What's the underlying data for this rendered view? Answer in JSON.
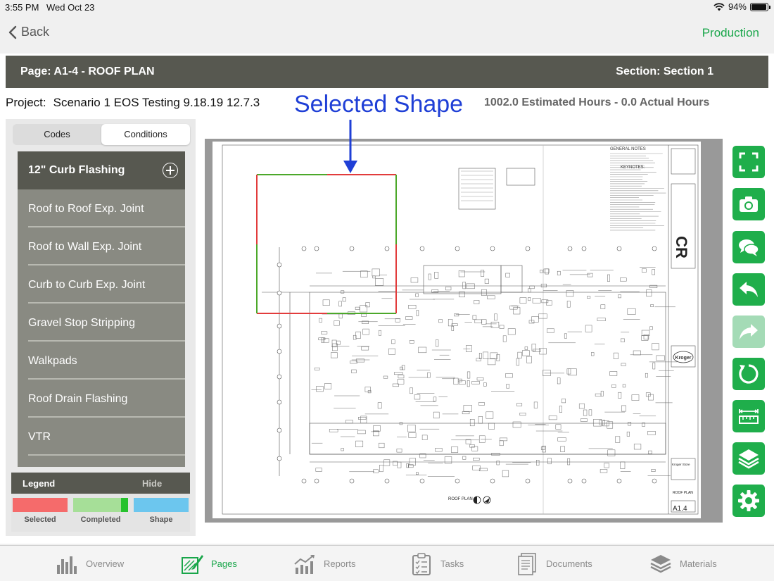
{
  "status_bar": {
    "time": "3:55 PM",
    "date": "Wed Oct 23",
    "battery": "94%",
    "battery_level": 0.94
  },
  "nav": {
    "back_label": "Back",
    "right_label": "Production"
  },
  "page_header": {
    "page": "Page: A1-4 - ROOF PLAN",
    "section": "Section: Section 1"
  },
  "project": {
    "label": "Project:",
    "name": "Scenario 1 EOS Testing 9.18.19 12.7.3",
    "hours": "1002.0 Estimated Hours - 0.0 Actual Hours"
  },
  "annotation": "Selected Shape",
  "tabs": [
    {
      "label": "Codes",
      "active": false
    },
    {
      "label": "Conditions",
      "active": true
    }
  ],
  "conditions": [
    {
      "label": "12\" Curb Flashing",
      "selected": true
    },
    {
      "label": "Roof to Roof Exp. Joint"
    },
    {
      "label": "Roof to Wall Exp. Joint"
    },
    {
      "label": "Curb to Curb Exp. Joint"
    },
    {
      "label": "Gravel Stop Stripping"
    },
    {
      "label": "Walkpads"
    },
    {
      "label": "Roof Drain Flashing"
    },
    {
      "label": "VTR"
    }
  ],
  "legend": {
    "title": "Legend",
    "hide_label": "Hide",
    "items": [
      {
        "label": "Selected",
        "color": "#f56b6b"
      },
      {
        "label": "Completed",
        "color": "#a6df98"
      },
      {
        "label": "Shape",
        "color": "#6cc6ee"
      }
    ]
  },
  "blueprint": {
    "notes_title": "GENERAL NOTES",
    "keynotes_title": "KEYNOTES:",
    "plan_title": "ROOF PLAN",
    "sheet_title": "ROOF PLAN",
    "sheet_number": "A1.4",
    "client_logo": "Kroger",
    "logo_letters": "CR",
    "client_name": "Kroger Store"
  },
  "toolbar": [
    {
      "icon": "fullscreen-icon"
    },
    {
      "icon": "camera-icon"
    },
    {
      "icon": "chat-icon"
    },
    {
      "icon": "undo-icon"
    },
    {
      "icon": "redo-icon",
      "disabled": true
    },
    {
      "icon": "refresh-icon"
    },
    {
      "icon": "measure-icon"
    },
    {
      "icon": "layers-icon"
    },
    {
      "icon": "gear-icon"
    }
  ],
  "bottom_tabs": [
    {
      "label": "Overview",
      "icon": "bar-chart-icon"
    },
    {
      "label": "Pages",
      "icon": "pages-icon",
      "active": true
    },
    {
      "label": "Reports",
      "icon": "reports-icon"
    },
    {
      "label": "Tasks",
      "icon": "tasks-icon"
    },
    {
      "label": "Documents",
      "icon": "documents-icon"
    },
    {
      "label": "Materials",
      "icon": "materials-icon"
    }
  ],
  "colors": {
    "accent_green": "#1fae4b",
    "header_gray": "#575850",
    "annotation_blue": "#1f3fd6",
    "shape_red": "#e23c3c",
    "shape_green": "#4ca82a"
  }
}
